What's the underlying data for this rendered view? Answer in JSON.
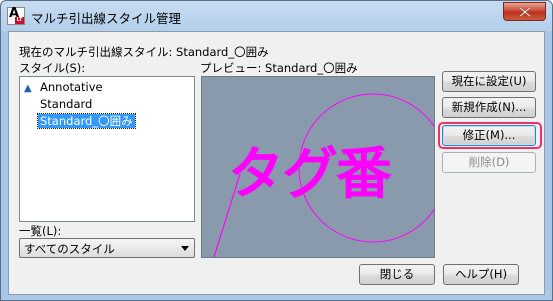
{
  "window": {
    "title": "マルチ引出線スタイル管理"
  },
  "header": {
    "current_style_label": "現在のマルチ引出線スタイル: Standard_〇囲み",
    "styles_label": "スタイル(S):",
    "preview_label": "プレビュー: Standard_〇囲み"
  },
  "style_list": {
    "items": [
      {
        "label": "Annotative",
        "icon": "annotative-icon",
        "selected": false
      },
      {
        "label": "Standard",
        "selected": false
      },
      {
        "label": "Standard_〇囲み",
        "selected": true
      }
    ]
  },
  "filter": {
    "label": "一覧(L):",
    "value": "すべてのスタイル"
  },
  "preview": {
    "sample_text": "タグ番",
    "leader_color": "#ff00ff",
    "background_color": "#8a9aad"
  },
  "buttons": {
    "set_current": "現在に設定(U)",
    "new": "新規作成(N)...",
    "modify": "修正(M)...",
    "delete": "削除(D)",
    "close": "閉じる",
    "help": "ヘルプ(H)"
  },
  "colors": {
    "highlight": "#e8336a",
    "selection": "#3399ff"
  }
}
